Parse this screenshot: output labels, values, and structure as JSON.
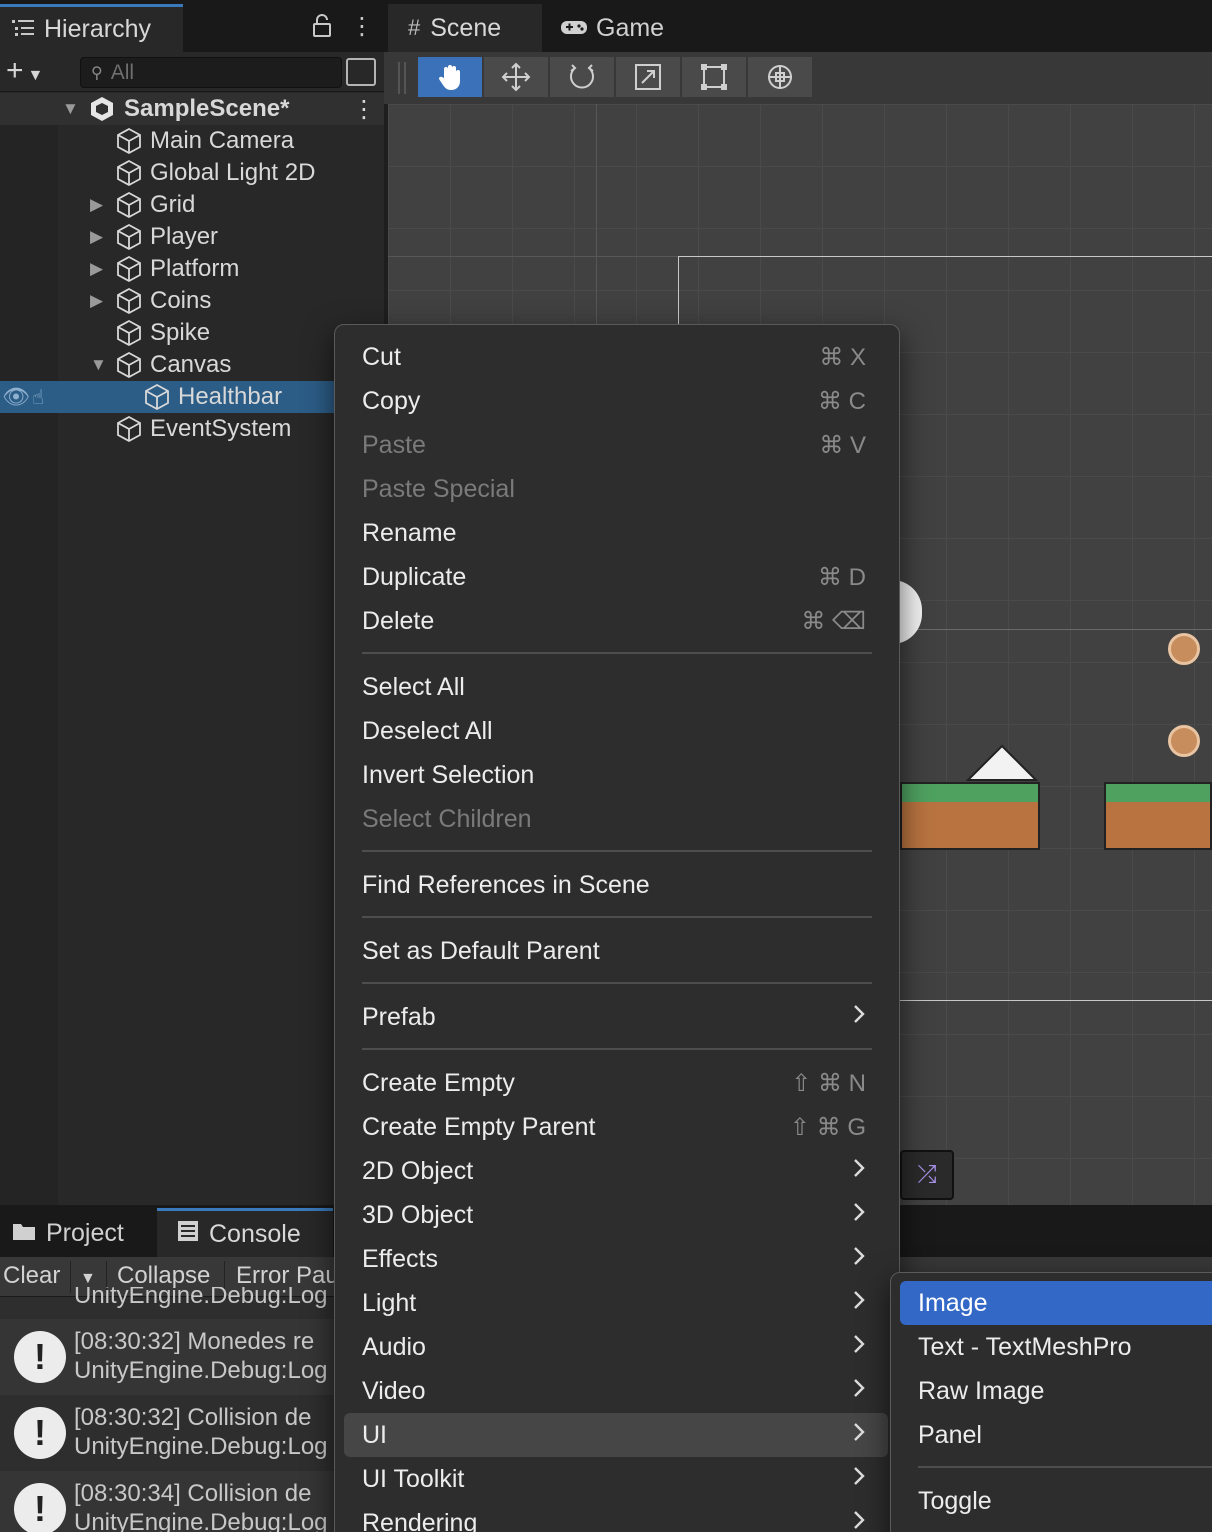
{
  "colors": {
    "accent": "#3a79bb",
    "selection": "#2c5d87",
    "menu_highlight": "#3368c6"
  },
  "hierarchy": {
    "tab_label": "Hierarchy",
    "search_placeholder": "All",
    "scene_name": "SampleScene*",
    "items": [
      {
        "label": "Main Camera",
        "expandable": false
      },
      {
        "label": "Global Light 2D",
        "expandable": false
      },
      {
        "label": "Grid",
        "expandable": true
      },
      {
        "label": "Player",
        "expandable": true
      },
      {
        "label": "Platform",
        "expandable": true
      },
      {
        "label": "Coins",
        "expandable": true
      },
      {
        "label": "Spike",
        "expandable": false
      },
      {
        "label": "Canvas",
        "expandable": true,
        "expanded": true
      },
      {
        "label": "Healthbar",
        "expandable": false,
        "selected": true
      },
      {
        "label": "EventSystem",
        "expandable": false
      }
    ]
  },
  "scene_view": {
    "tabs": [
      {
        "label": "Scene",
        "icon": "grid-icon"
      },
      {
        "label": "Game",
        "icon": "gamepad-icon"
      }
    ],
    "tools": [
      "hand-tool-icon",
      "move-tool-icon",
      "rotate-tool-icon",
      "scale-tool-icon",
      "rect-tool-icon",
      "transform-tool-icon"
    ],
    "active_tool": "hand-tool-icon"
  },
  "bottom": {
    "tabs": [
      {
        "label": "Project",
        "icon": "folder-icon"
      },
      {
        "label": "Console",
        "icon": "console-icon"
      }
    ],
    "toolbar": {
      "clear": "Clear",
      "collapse": "Collapse",
      "error_pause": "Error Pau"
    },
    "partial_log": "UnityEngine.Debug:Log",
    "logs": [
      {
        "line1": "[08:30:32] Monedes re",
        "line2": "UnityEngine.Debug:Log"
      },
      {
        "line1": "[08:30:32] Collision de",
        "line2": "UnityEngine.Debug:Log"
      },
      {
        "line1": "[08:30:34] Collision de",
        "line2": "UnityEngine.Debug:Log"
      }
    ]
  },
  "context_menu": {
    "items": [
      {
        "label": "Cut",
        "shortcut": "⌘ X"
      },
      {
        "label": "Copy",
        "shortcut": "⌘ C"
      },
      {
        "label": "Paste",
        "shortcut": "⌘ V",
        "disabled": true
      },
      {
        "label": "Paste Special",
        "disabled": true
      },
      {
        "label": "Rename"
      },
      {
        "label": "Duplicate",
        "shortcut": "⌘ D"
      },
      {
        "label": "Delete",
        "shortcut": "⌘ ⌫"
      },
      {
        "label": "Select All"
      },
      {
        "label": "Deselect All"
      },
      {
        "label": "Invert Selection"
      },
      {
        "label": "Select Children",
        "disabled": true
      },
      {
        "label": "Find References in Scene"
      },
      {
        "label": "Set as Default Parent"
      },
      {
        "label": "Prefab",
        "submenu": true
      },
      {
        "label": "Create Empty",
        "shortcut": "⇧ ⌘ N"
      },
      {
        "label": "Create Empty Parent",
        "shortcut": "⇧ ⌘ G"
      },
      {
        "label": "2D Object",
        "submenu": true
      },
      {
        "label": "3D Object",
        "submenu": true
      },
      {
        "label": "Effects",
        "submenu": true
      },
      {
        "label": "Light",
        "submenu": true
      },
      {
        "label": "Audio",
        "submenu": true
      },
      {
        "label": "Video",
        "submenu": true
      },
      {
        "label": "UI",
        "submenu": true,
        "highlighted": true
      },
      {
        "label": "UI Toolkit",
        "submenu": true
      },
      {
        "label": "Rendering",
        "submenu": true
      }
    ]
  },
  "ui_submenu": {
    "items": [
      {
        "label": "Image",
        "active": true
      },
      {
        "label": "Text - TextMeshPro"
      },
      {
        "label": "Raw Image"
      },
      {
        "label": "Panel"
      },
      {
        "label": "Toggle"
      }
    ]
  }
}
